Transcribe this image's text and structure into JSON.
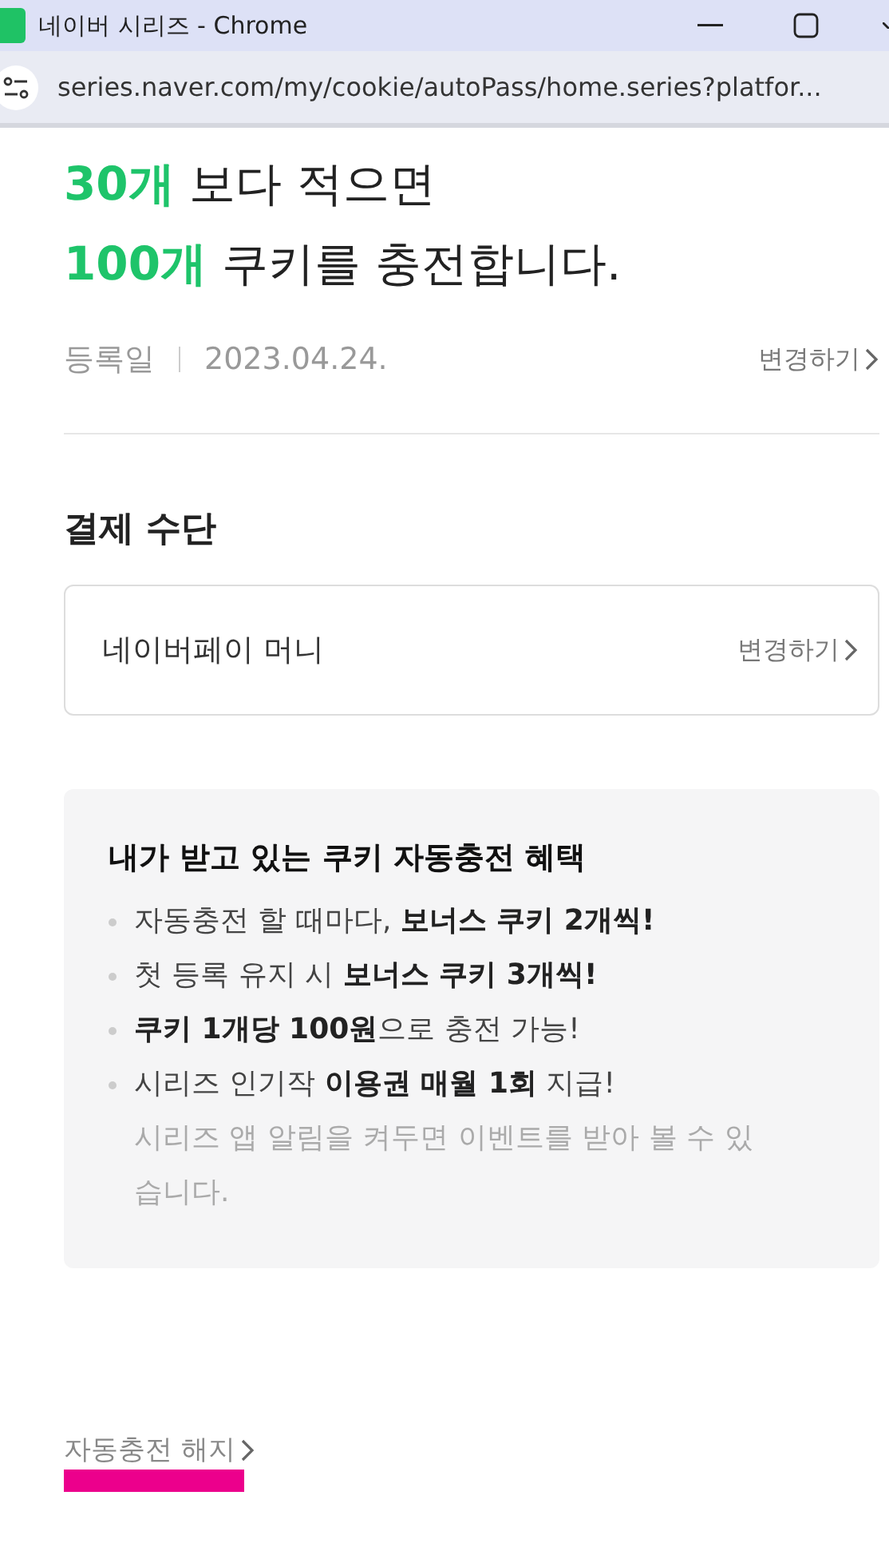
{
  "window": {
    "title": "네이버 시리즈 - Chrome"
  },
  "address_bar": {
    "url": "series.naver.com/my/cookie/autoPass/home.series?platfor..."
  },
  "headline": [
    "**30개** 보다 적으면",
    "**100개** 쿠키를 충전합니다."
  ],
  "registration": {
    "label": "등록일",
    "date": "2023.04.24.",
    "action": "변경하기"
  },
  "payment": {
    "title": "결제 수단",
    "method": "네이버페이 머니",
    "action": "변경하기"
  },
  "benefits": {
    "title": "내가 받고 있는 쿠키 자동충전 혜택",
    "items": [
      {
        "kind": "bullet",
        "text": "자동충전 할 때마다, **보너스 쿠키 2개씩!**"
      },
      {
        "kind": "bullet",
        "text": "첫 등록 유지 시 **보너스 쿠키 3개씩!**"
      },
      {
        "kind": "bullet",
        "text": "**쿠키 1개당 100원**으로 충전 가능!"
      },
      {
        "kind": "bullet",
        "text": "시리즈 인기작 **이용권 매월 1회** 지급!"
      },
      {
        "kind": "note",
        "text": "시리즈 앱 알림을 켜두면 이벤트를 받아 볼 수 있습니다."
      }
    ]
  },
  "cancel": {
    "label": "자동충전 해지",
    "highlighted": true
  }
}
